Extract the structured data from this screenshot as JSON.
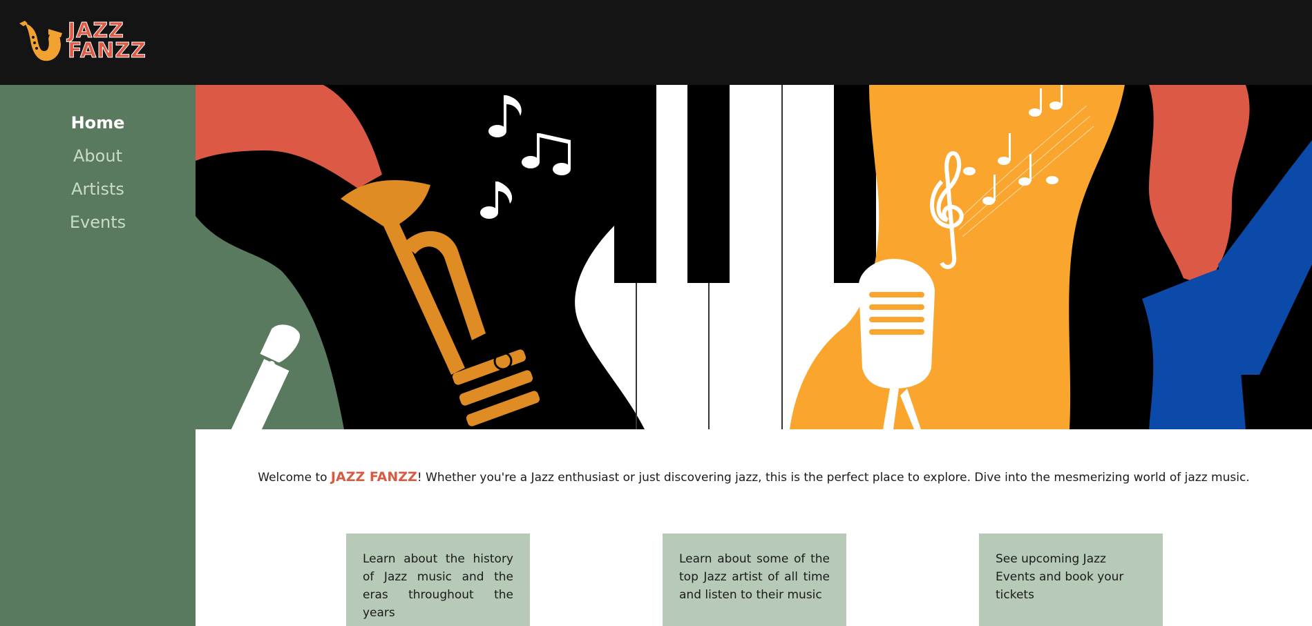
{
  "header": {
    "logo_line1": "JAZZ",
    "logo_line2": "FANZZ"
  },
  "nav": {
    "items": [
      {
        "label": "Home",
        "active": true
      },
      {
        "label": "About",
        "active": false
      },
      {
        "label": "Artists",
        "active": false
      },
      {
        "label": "Events",
        "active": false
      }
    ]
  },
  "main": {
    "welcome_prefix": "Welcome to ",
    "welcome_brand": "JAZZ FANZZ",
    "welcome_suffix": "! Whether you're a Jazz enthusiast or just discovering jazz, this is the perfect place to explore. Dive into the mesmerizing world of jazz music.",
    "cards": [
      {
        "text": "Learn about the history of Jazz music and the eras throughout the years"
      },
      {
        "text": "Learn about some of the top Jazz artist of all time and listen to their music"
      },
      {
        "text": "See upcoming Jazz Events and book your tickets"
      }
    ]
  },
  "colors": {
    "topbar": "#141414",
    "sidebar": "#5a7a5f",
    "card": "#b6cab7",
    "brand": "#d95a43",
    "accent_orange": "#f9a52e",
    "accent_blue": "#0b4aa8"
  }
}
